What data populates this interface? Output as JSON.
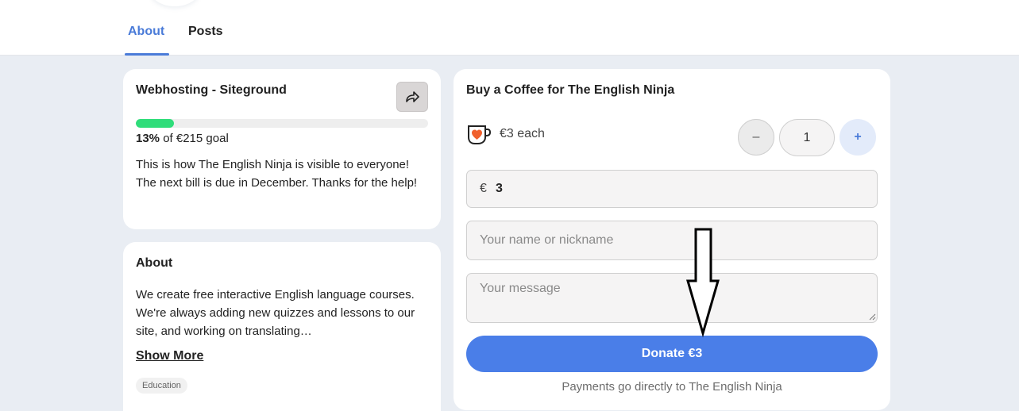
{
  "tabs": [
    {
      "label": "About",
      "active": true
    },
    {
      "label": "Posts",
      "active": false
    }
  ],
  "goal": {
    "title": "Webhosting - Siteground",
    "progress_percent": 13,
    "percent_label": "13%",
    "goal_suffix": " of €215 goal",
    "description": "This is how The English Ninja is visible to everyone! The next bill is due in December. Thanks for the help!",
    "share_icon": "share-icon"
  },
  "about": {
    "title": "About",
    "text": "We create free interactive English language courses. We're always adding new quizzes and lessons to our site, and working on translating…",
    "show_more": "Show More",
    "tag": "Education"
  },
  "donate": {
    "title": "Buy a Coffee for The English Ninja",
    "price_each": "€3 each",
    "qty_minus": "–",
    "qty_value": "1",
    "qty_plus": "+",
    "currency_symbol": "€",
    "amount": "3",
    "name_placeholder": "Your name or nickname",
    "message_placeholder": "Your message",
    "button_label": "Donate €3",
    "note": "Payments go directly to The English Ninja"
  },
  "colors": {
    "accent": "#4a7ee8",
    "progress": "#2fdd7a",
    "tab_active": "#4a7bd8"
  }
}
